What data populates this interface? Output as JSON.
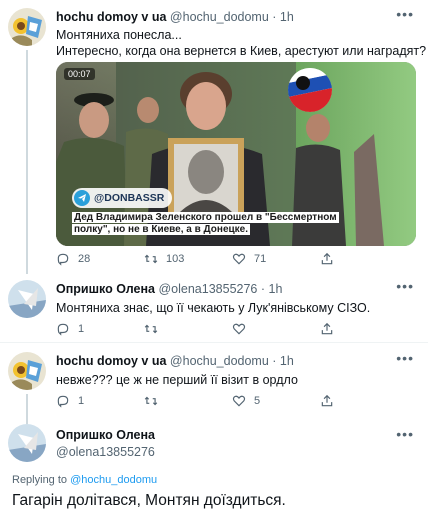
{
  "tweets": [
    {
      "name": "hochu domoy v ua",
      "handle": "@hochu_dodomu",
      "time": "· 1h",
      "lines": [
        "Монтяниха понесла...",
        "Интересно, когда она вернется в Киев, арестуют или наградят?"
      ],
      "media": {
        "timestamp": "00:07",
        "source": "@DONBASSR",
        "caption": "Дед Владимира Зеленского прошел в \"Бессмертном полку\", но не в Киеве, а в Донецке."
      },
      "replies": "28",
      "retweets": "103",
      "likes": "71"
    },
    {
      "name": "Опришко Олена",
      "handle": "@olena13855276",
      "time": "· 1h",
      "lines": [
        "Монтяниха знає, що її чекають  у Лук'янівському СІЗО."
      ],
      "replies": "1",
      "retweets": "",
      "likes": ""
    },
    {
      "name": "hochu domoy v ua",
      "handle": "@hochu_dodomu",
      "time": "· 1h",
      "lines": [
        "невже??? це ж не перший її візит в ордло"
      ],
      "replies": "1",
      "retweets": "",
      "likes": "5"
    },
    {
      "name": "Опришко Олена",
      "handle": "@olena13855276"
    }
  ],
  "replying": {
    "prefix": "Replying to",
    "target": "@hochu_dodomu"
  },
  "main_reply": "Гагарін долітався, Монтян доїздиться.",
  "icons": {
    "more": "more-icon",
    "reply": "reply-icon",
    "retweet": "retweet-icon",
    "like": "like-icon",
    "share": "share-icon"
  },
  "colors": {
    "text": "#0f1419",
    "secondary": "#536471",
    "link": "#1d9bf0",
    "thread": "#cfd9de"
  }
}
